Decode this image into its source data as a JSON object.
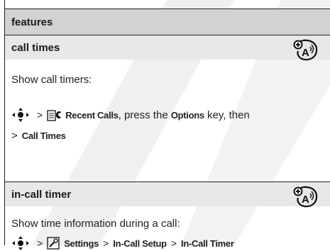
{
  "header": {
    "title": "features"
  },
  "sections": [
    {
      "title": "call times",
      "description": "Show call timers:",
      "path_line1": {
        "menu": "Recent Calls",
        "text1": ", press the ",
        "key": "Options",
        "text2": " key, then"
      },
      "path_line2": {
        "gt": ">",
        "item": "Call Times"
      }
    },
    {
      "title": "in-call timer",
      "description": "Show time information during a call:",
      "path": {
        "gt": ">",
        "menu": "Settings",
        "item1": "In-Call Setup",
        "item2": "In-Call Timer"
      }
    }
  ],
  "icons": {
    "nav_key": "nav-key-icon",
    "recent_calls": "recent-calls-icon",
    "settings": "settings-icon",
    "network_feature": "network-feature-icon"
  }
}
